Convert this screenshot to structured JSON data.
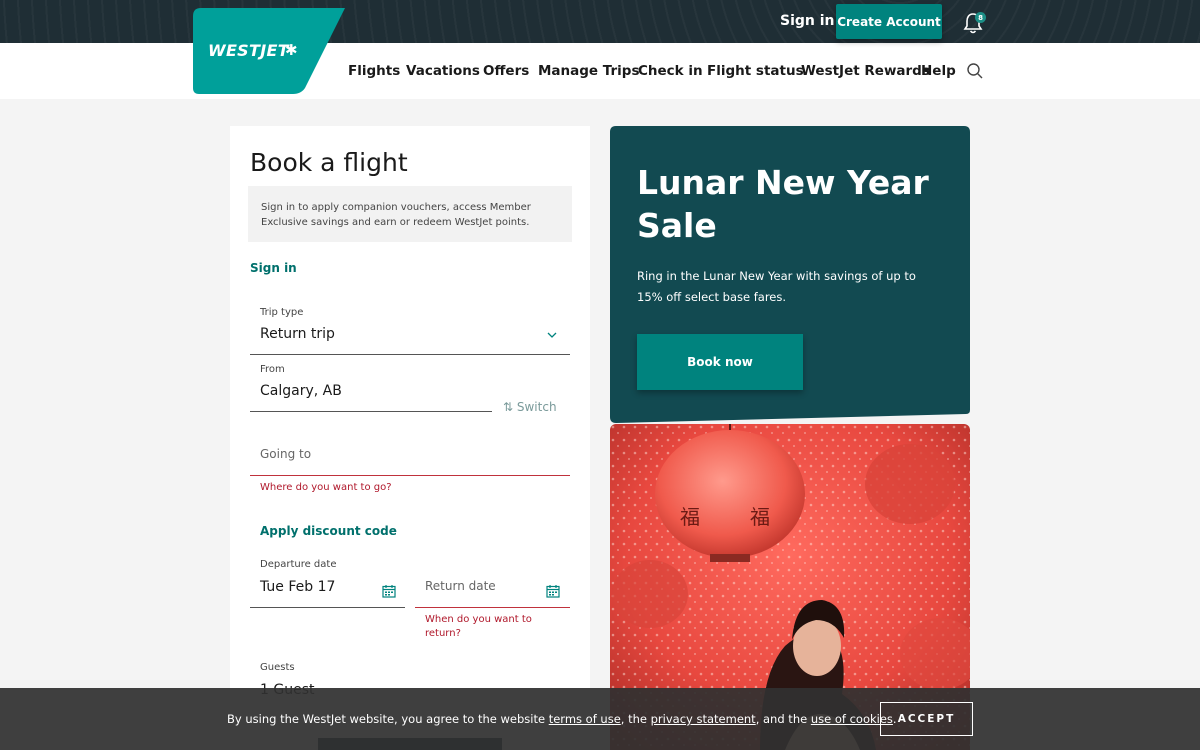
{
  "header": {
    "logo_text": "WESTJET",
    "sign_in": "Sign in",
    "create_account": "Create Account",
    "notification_count": "8"
  },
  "nav": {
    "items": [
      "Flights",
      "Vacations",
      "Offers",
      "Manage Trips",
      "Check in",
      "Flight status",
      "WestJet Rewards",
      "Help"
    ]
  },
  "booking": {
    "title": "Book a flight",
    "info": "Sign in to apply companion vouchers, access Member Exclusive savings and earn or redeem WestJet points.",
    "sign_in_link": "Sign in",
    "trip_type_label": "Trip type",
    "trip_type_value": "Return trip",
    "from_label": "From",
    "from_value": "Calgary, AB",
    "switch_label": "Switch",
    "going_to_placeholder": "Going to",
    "going_to_error": "Where do you want to go?",
    "discount_link": "Apply discount code",
    "departure_label": "Departure date",
    "departure_value": "Tue Feb 17",
    "return_placeholder": "Return date",
    "return_error": "When do you want to return?",
    "guests_label": "Guests",
    "guests_value": "1 Guest"
  },
  "promo": {
    "title": "Lunar New Year Sale",
    "text": "Ring in the Lunar New Year with savings of up to 15% off select base fares.",
    "button": "Book now"
  },
  "cookie": {
    "prefix": "By using the WestJet website, you agree to the website ",
    "terms_link": "terms of use",
    "middle": ", the ",
    "privacy_link": "privacy statement",
    "and": ", and the ",
    "cookies_link": "use of cookies",
    "suffix": ".",
    "accept": "ACCEPT"
  },
  "colors": {
    "brand_teal": "#00a09a",
    "button_teal": "#00837e",
    "promo_bg": "#124a51",
    "top_bar": "#1f2e35",
    "error": "#c0323c"
  },
  "icons": [
    "maple-leaf-icon",
    "bell-icon",
    "search-icon",
    "chevron-down-icon",
    "swap-icon",
    "calendar-icon"
  ]
}
